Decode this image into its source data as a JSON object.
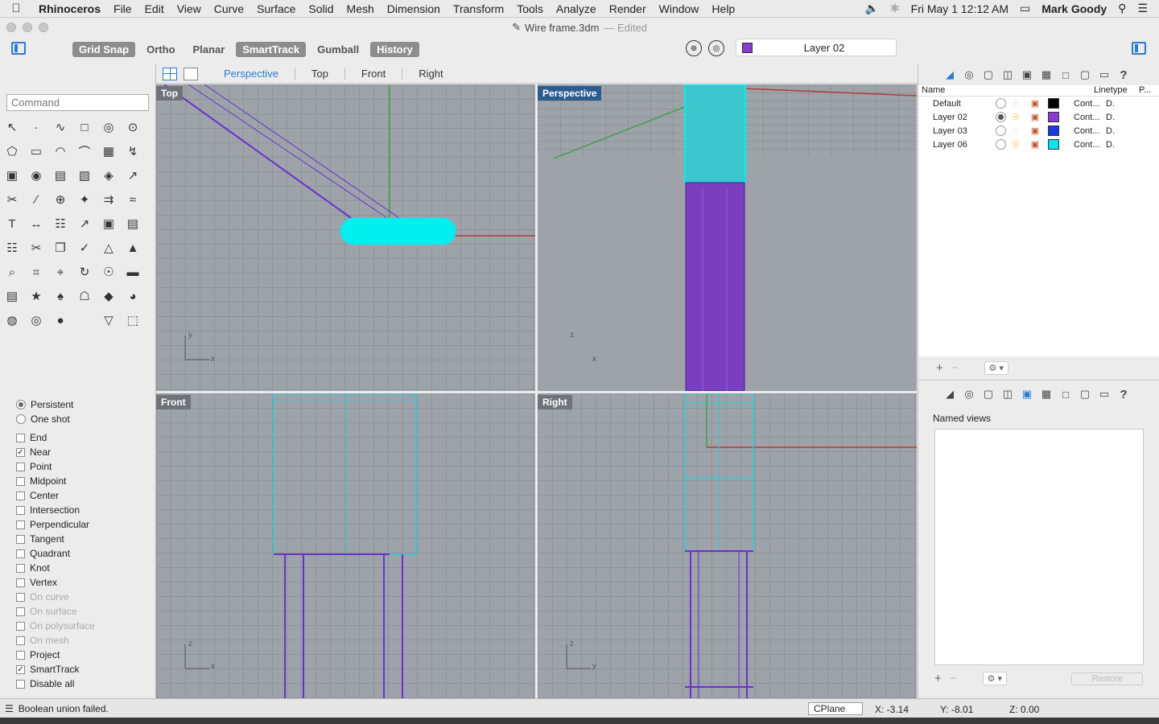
{
  "menubar": {
    "app": "Rhinoceros",
    "items": [
      "File",
      "Edit",
      "View",
      "Curve",
      "Surface",
      "Solid",
      "Mesh",
      "Dimension",
      "Transform",
      "Tools",
      "Analyze",
      "Render",
      "Window",
      "Help"
    ],
    "datetime": "Fri May 1  12:12 AM",
    "user": "Mark Goody"
  },
  "window": {
    "title": "Wire frame.3dm",
    "status": "— Edited"
  },
  "toolbar": {
    "buttons": [
      {
        "label": "Grid Snap",
        "on": true
      },
      {
        "label": "Ortho",
        "on": false
      },
      {
        "label": "Planar",
        "on": false
      },
      {
        "label": "SmartTrack",
        "on": true
      },
      {
        "label": "Gumball",
        "on": false
      },
      {
        "label": "History",
        "on": true
      }
    ],
    "current_layer": "Layer 02",
    "current_layer_color": "#8a3bd1"
  },
  "viewport_tabs": [
    "Perspective",
    "Top",
    "Front",
    "Right"
  ],
  "active_tab": "Perspective",
  "command": {
    "placeholder": "Command"
  },
  "viewports": {
    "top": {
      "label": "Top",
      "ax1": "y",
      "ax2": "x"
    },
    "perspective": {
      "label": "Perspective",
      "ax1": "z",
      "ax2": "x"
    },
    "front": {
      "label": "Front",
      "ax1": "z",
      "ax2": "x"
    },
    "right": {
      "label": "Right",
      "ax1": "z",
      "ax2": "y"
    }
  },
  "osnap": {
    "modes": [
      {
        "label": "Persistent",
        "selected": true
      },
      {
        "label": "One shot",
        "selected": false
      }
    ],
    "options": [
      {
        "label": "End",
        "checked": false,
        "disabled": false
      },
      {
        "label": "Near",
        "checked": true,
        "disabled": false
      },
      {
        "label": "Point",
        "checked": false,
        "disabled": false
      },
      {
        "label": "Midpoint",
        "checked": false,
        "disabled": false
      },
      {
        "label": "Center",
        "checked": false,
        "disabled": false
      },
      {
        "label": "Intersection",
        "checked": false,
        "disabled": false
      },
      {
        "label": "Perpendicular",
        "checked": false,
        "disabled": false
      },
      {
        "label": "Tangent",
        "checked": false,
        "disabled": false
      },
      {
        "label": "Quadrant",
        "checked": false,
        "disabled": false
      },
      {
        "label": "Knot",
        "checked": false,
        "disabled": false
      },
      {
        "label": "Vertex",
        "checked": false,
        "disabled": false
      },
      {
        "label": "On curve",
        "checked": false,
        "disabled": true
      },
      {
        "label": "On surface",
        "checked": false,
        "disabled": true
      },
      {
        "label": "On polysurface",
        "checked": false,
        "disabled": true
      },
      {
        "label": "On mesh",
        "checked": false,
        "disabled": true
      },
      {
        "label": "Project",
        "checked": false,
        "disabled": false
      },
      {
        "label": "SmartTrack",
        "checked": true,
        "disabled": false
      },
      {
        "label": "Disable all",
        "checked": false,
        "disabled": false
      }
    ]
  },
  "layers": {
    "headers": {
      "name": "Name",
      "linetype": "Linetype",
      "print": "P..."
    },
    "rows": [
      {
        "name": "Default",
        "current": false,
        "on": false,
        "color": "#000000",
        "linetype": "Cont...",
        "print": "D."
      },
      {
        "name": "Layer 02",
        "current": true,
        "on": true,
        "color": "#8a3bd1",
        "linetype": "Cont...",
        "print": "D."
      },
      {
        "name": "Layer 03",
        "current": false,
        "on": false,
        "color": "#1a3be0",
        "linetype": "Cont...",
        "print": "D."
      },
      {
        "name": "Layer 06",
        "current": false,
        "on": true,
        "color": "#00e5f0",
        "linetype": "Cont...",
        "print": "D."
      }
    ]
  },
  "named_views": {
    "title": "Named views",
    "restore": "Restore"
  },
  "status": {
    "message": "Boolean union failed.",
    "cplane": "CPlane",
    "x": "X: -3.14",
    "y": "Y: -8.01",
    "z": "Z: 0.00"
  }
}
